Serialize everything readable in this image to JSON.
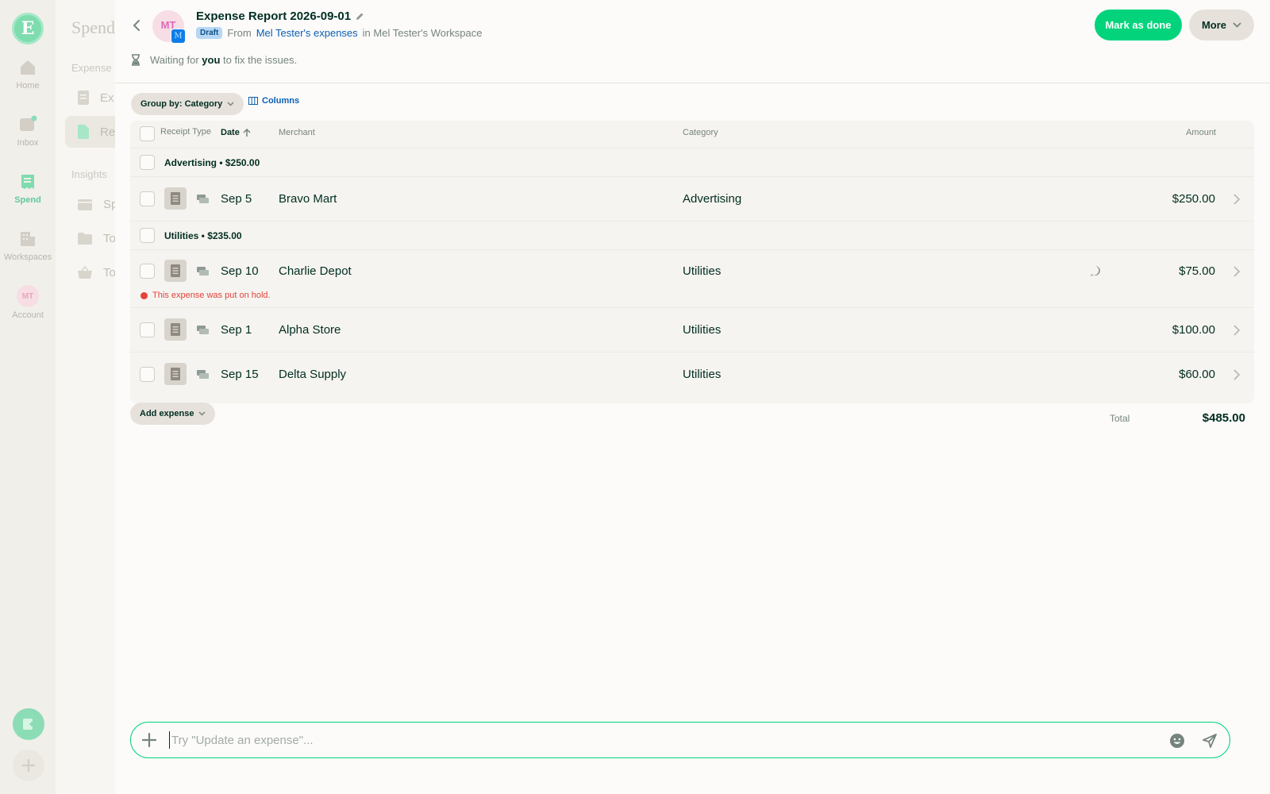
{
  "rail": {
    "logo": "E",
    "items": [
      {
        "label": "Home",
        "icon": "home-icon"
      },
      {
        "label": "Inbox",
        "icon": "inbox-icon"
      },
      {
        "label": "Spend",
        "icon": "receipt-icon"
      },
      {
        "label": "Workspaces",
        "icon": "building-icon"
      },
      {
        "label": "Account",
        "avatar": "MT"
      }
    ]
  },
  "subnav": {
    "title": "Spend",
    "section1": "Expense r",
    "section2": "Insights",
    "items": [
      "Ex",
      "Re",
      "Sp",
      "To",
      "To"
    ]
  },
  "header": {
    "avatar": "MT",
    "avatar_sub": "M",
    "title": "Expense Report 2026-09-01",
    "badge": "Draft",
    "from_prefix": "From",
    "from_link": "Mel Tester's expenses",
    "in_text": "in Mel Tester's Workspace",
    "mark_done": "Mark as done",
    "more": "More",
    "waiting_prefix": "Waiting for",
    "waiting_bold": "you",
    "waiting_suffix": "to fix the issues."
  },
  "toolbar": {
    "group_by": "Group by: Category",
    "columns": "Columns"
  },
  "table": {
    "headers": {
      "receipt_type": "Receipt Type",
      "date": "Date",
      "merchant": "Merchant",
      "category": "Category",
      "amount": "Amount"
    },
    "groups": [
      {
        "label": "Advertising • $250.00",
        "rows": [
          {
            "date": "Sep 5",
            "merchant": "Bravo Mart",
            "category": "Advertising",
            "amount": "$250.00"
          }
        ]
      },
      {
        "label": "Utilities • $235.00",
        "rows": [
          {
            "date": "Sep 10",
            "merchant": "Charlie Depot",
            "category": "Utilities",
            "amount": "$75.00",
            "note": "This expense was put on hold.",
            "has_comment": true
          },
          {
            "date": "Sep 1",
            "merchant": "Alpha Store",
            "category": "Utilities",
            "amount": "$100.00"
          },
          {
            "date": "Sep 15",
            "merchant": "Delta Supply",
            "category": "Utilities",
            "amount": "$60.00"
          }
        ]
      }
    ]
  },
  "footer": {
    "add_expense": "Add expense",
    "total_label": "Total",
    "total_value": "$485.00"
  },
  "composer": {
    "placeholder": "Try \"Update an expense\"..."
  },
  "colors": {
    "accent": "#03d47c",
    "link": "#0a5fb4",
    "danger": "#e5423a",
    "text": "#002e22"
  }
}
